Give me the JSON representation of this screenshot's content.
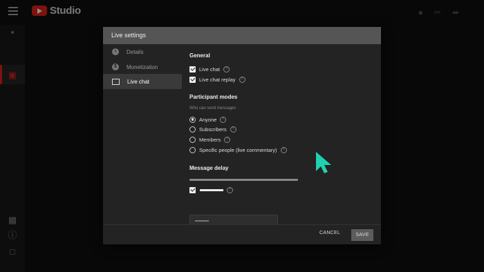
{
  "app": {
    "logo_text": "Studio"
  },
  "dialog": {
    "title": "Live settings",
    "nav": [
      {
        "label": "Details",
        "icon": "info-icon"
      },
      {
        "label": "Monetization",
        "icon": "dollar-icon"
      },
      {
        "label": "Live chat",
        "icon": "chat-icon",
        "active": true
      }
    ],
    "general": {
      "title": "General",
      "live_chat": "Live chat",
      "live_chat_replay": "Live chat replay"
    },
    "participant": {
      "title": "Participant modes",
      "subtitle": "Who can send messages",
      "options": [
        "Anyone",
        "Subscribers",
        "Members",
        "Specific people (live commentary)"
      ],
      "selected": "Anyone"
    },
    "delay": {
      "title": "Message delay"
    },
    "cancel_label": "CANCEL",
    "save_label": "SAVE"
  },
  "colors": {
    "brand_red": "#e62117",
    "cursor_teal": "#1fd1b0"
  }
}
